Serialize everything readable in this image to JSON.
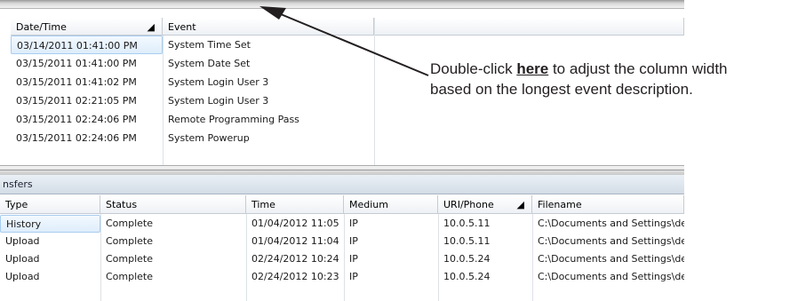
{
  "event_grid": {
    "columns": [
      "Date/Time",
      "Event"
    ],
    "rows": [
      {
        "datetime": "03/14/2011 01:41:00 PM",
        "event": "System Time Set"
      },
      {
        "datetime": "03/15/2011 01:41:00 PM",
        "event": "System Date Set"
      },
      {
        "datetime": "03/15/2011 01:41:02 PM",
        "event": "System Login User 3"
      },
      {
        "datetime": "03/15/2011 02:21:05 PM",
        "event": "System Login User 3"
      },
      {
        "datetime": "03/15/2011 02:24:06 PM",
        "event": "Remote Programming Pass"
      },
      {
        "datetime": "03/15/2011 02:24:06 PM",
        "event": "System Powerup"
      }
    ],
    "selected_row": 0,
    "sorted_column": "Date/Time"
  },
  "transfers": {
    "title": "nsfers",
    "columns": [
      "Type",
      "Status",
      "Time",
      "Medium",
      "URI/Phone",
      "Filename"
    ],
    "sorted_column": "URI/Phone",
    "rows": [
      {
        "type": "History",
        "status": "Complete",
        "time": "01/04/2012 11:05",
        "medium": "IP",
        "uri": "10.0.5.11",
        "filename": "C:\\Documents and Settings\\de"
      },
      {
        "type": "Upload",
        "status": "Complete",
        "time": "01/04/2012 11:04",
        "medium": "IP",
        "uri": "10.0.5.11",
        "filename": "C:\\Documents and Settings\\de"
      },
      {
        "type": "Upload",
        "status": "Complete",
        "time": "02/24/2012 10:24",
        "medium": "IP",
        "uri": "10.0.5.24",
        "filename": "C:\\Documents and Settings\\de"
      },
      {
        "type": "Upload",
        "status": "Complete",
        "time": "02/24/2012 10:23",
        "medium": "IP",
        "uri": "10.0.5.24",
        "filename": "C:\\Documents and Settings\\de"
      }
    ],
    "selected_row": 0
  },
  "annotation": {
    "line1_before": "Double-click ",
    "line1_link": "here",
    "line1_after": " to adjust the column width",
    "line2": "based on the longest event description."
  },
  "icons": {
    "sort": "sort-indicator-icon",
    "arrow": "callout-arrow-icon"
  },
  "colors": {
    "selection_fill": "#deedfb",
    "selection_border": "#a7cdf0",
    "header_gradient_end": "#eef1f5",
    "panel_title_bg": "#d3dce6"
  }
}
